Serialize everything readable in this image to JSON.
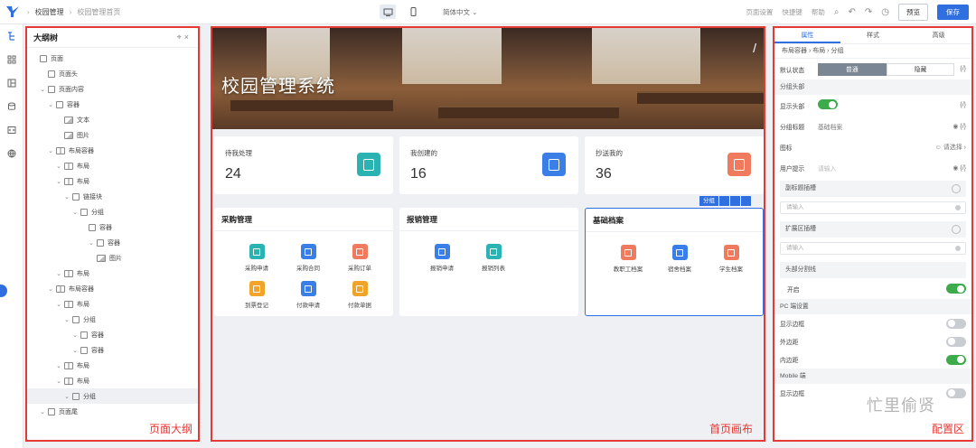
{
  "topbar": {
    "breadcrumb": [
      "校园管理",
      "校园管理首页"
    ],
    "language": "简体中文",
    "links": [
      "页面设置",
      "快捷键",
      "帮助"
    ],
    "preview": "预览",
    "save": "保存"
  },
  "outline": {
    "title": "大纲树",
    "tag": "页面大纲",
    "nodes": [
      {
        "label": "页面",
        "indent": 0
      },
      {
        "label": "页面头",
        "indent": 1
      },
      {
        "label": "页面内容",
        "indent": 1
      },
      {
        "label": "容器",
        "indent": 2
      },
      {
        "label": "文本",
        "indent": 3
      },
      {
        "label": "图片",
        "indent": 3
      },
      {
        "label": "布局容器",
        "indent": 2
      },
      {
        "label": "布局",
        "indent": 3
      },
      {
        "label": "布局",
        "indent": 3
      },
      {
        "label": "链接块",
        "indent": 4
      },
      {
        "label": "分组",
        "indent": 5
      },
      {
        "label": "容器",
        "indent": 6
      },
      {
        "label": "容器",
        "indent": 7
      },
      {
        "label": "图片",
        "indent": 7
      },
      {
        "label": "布局",
        "indent": 3
      },
      {
        "label": "布局容器",
        "indent": 2
      },
      {
        "label": "布局",
        "indent": 3
      },
      {
        "label": "分组",
        "indent": 4
      },
      {
        "label": "容器",
        "indent": 5
      },
      {
        "label": "容器",
        "indent": 5
      },
      {
        "label": "布局",
        "indent": 3
      },
      {
        "label": "布局",
        "indent": 3
      },
      {
        "label": "分组",
        "indent": 4
      },
      {
        "label": "页面尾",
        "indent": 1
      }
    ]
  },
  "canvas": {
    "banner_title": "校园管理系统",
    "tag": "首页画布",
    "stats": [
      {
        "label": "待我处理",
        "value": "24",
        "color": "#2bb3b3"
      },
      {
        "label": "我创建的",
        "value": "16",
        "color": "#3a7fe8"
      },
      {
        "label": "抄送我的",
        "value": "36",
        "color": "#f07a5e"
      }
    ],
    "cards": [
      {
        "title": "采购管理",
        "apps": [
          {
            "name": "采购申请",
            "color": "#2bb3b3"
          },
          {
            "name": "采购合同",
            "color": "#3a7fe8"
          },
          {
            "name": "采购订单",
            "color": "#f07a5e"
          },
          {
            "name": "到票登记",
            "color": "#f0a52a"
          },
          {
            "name": "付款申请",
            "color": "#3a7fe8"
          },
          {
            "name": "付款单据",
            "color": "#f0a52a"
          }
        ]
      },
      {
        "title": "报销管理",
        "apps": [
          {
            "name": "报销申请",
            "color": "#3a7fe8"
          },
          {
            "name": "报销列表",
            "color": "#2bb3b3"
          }
        ]
      },
      {
        "title": "基础档案",
        "apps": [
          {
            "name": "教职工档案",
            "color": "#f07a5e"
          },
          {
            "name": "宿舍档案",
            "color": "#3a7fe8"
          },
          {
            "name": "学生档案",
            "color": "#f07a5e"
          }
        ]
      }
    ],
    "selected_label": "分组"
  },
  "config": {
    "tabs": [
      "属性",
      "样式",
      "高级"
    ],
    "breadcrumb": [
      "布局容器",
      "布局",
      "分组"
    ],
    "default_state_label": "默认状态",
    "default_state_options": [
      "普通",
      "隐藏"
    ],
    "section_head": "分组头部",
    "show_head": "显示头部",
    "group_title_label": "分组标题",
    "group_title_value": "基础档案",
    "icon_label": "图标",
    "icon_value": "请选择",
    "user_hint_label": "用户提示",
    "placeholder": "请输入",
    "subtitle_slot": "副标题插槽",
    "extend_slot": "扩展区插槽",
    "divider_section": "头部分割线",
    "enable_label": "开启",
    "pc_section": "PC 端设置",
    "show_border": "显示边框",
    "outer_margin": "外边距",
    "inner_padding": "内边距",
    "mobile_section": "Mobile 端",
    "watermark": "忙里偷贤",
    "tag": "配置区"
  }
}
